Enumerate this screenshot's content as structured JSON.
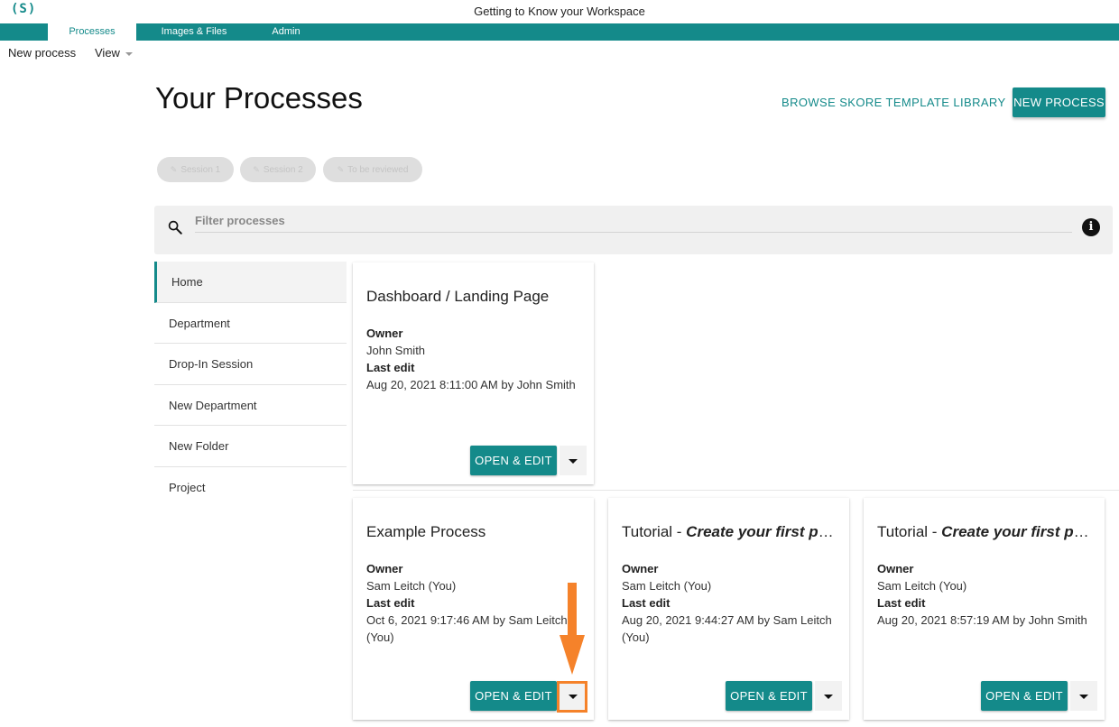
{
  "app": {
    "logo": "(S)",
    "window_title": "Getting to Know your Workspace"
  },
  "tabs": [
    {
      "label": "Processes",
      "active": true
    },
    {
      "label": "Images & Files",
      "active": false
    },
    {
      "label": "Admin",
      "active": false
    }
  ],
  "menubar": {
    "new_process": "New process",
    "view": "View"
  },
  "header": {
    "title": "Your Processes",
    "browse_label": "BROWSE SKORE TEMPLATE LIBRARY",
    "new_process_label": "NEW PROCESS"
  },
  "chips": [
    {
      "label": "Session 1"
    },
    {
      "label": "Session 2"
    },
    {
      "label": "To be reviewed"
    }
  ],
  "filter": {
    "placeholder": "Filter processes"
  },
  "sidebar": {
    "items": [
      {
        "label": "Home",
        "active": true
      },
      {
        "label": "Department"
      },
      {
        "label": "Drop-In Session"
      },
      {
        "label": "New Department"
      },
      {
        "label": "New Folder"
      },
      {
        "label": "Project"
      }
    ]
  },
  "cards": [
    {
      "title": "Dashboard / Landing Page",
      "owner_label": "Owner",
      "owner": "John Smith",
      "last_edit_label": "Last edit",
      "last_edit": "Aug 20, 2021 8:11:00 AM by John Smith",
      "open_label": "OPEN & EDIT"
    },
    {
      "title": "Example Process",
      "owner_label": "Owner",
      "owner": "Sam Leitch (You)",
      "last_edit_label": "Last edit",
      "last_edit": "Oct 6, 2021 9:17:46 AM by Sam Leitch (You)",
      "open_label": "OPEN & EDIT"
    },
    {
      "title_prefix": "Tutorial - ",
      "title_emph": "Create your first process",
      "owner_label": "Owner",
      "owner": "Sam Leitch (You)",
      "last_edit_label": "Last edit",
      "last_edit": "Aug 20, 2021 9:44:27 AM by Sam Leitch (You)",
      "open_label": "OPEN & EDIT"
    },
    {
      "title_prefix": "Tutorial - ",
      "title_emph": "Create your first process",
      "owner_label": "Owner",
      "owner": "Sam Leitch (You)",
      "last_edit_label": "Last edit",
      "last_edit": "Aug 20, 2021 8:57:19 AM by John Smith",
      "open_label": "OPEN & EDIT"
    }
  ],
  "colors": {
    "accent": "#148a8a",
    "annotation": "#f5822a"
  }
}
